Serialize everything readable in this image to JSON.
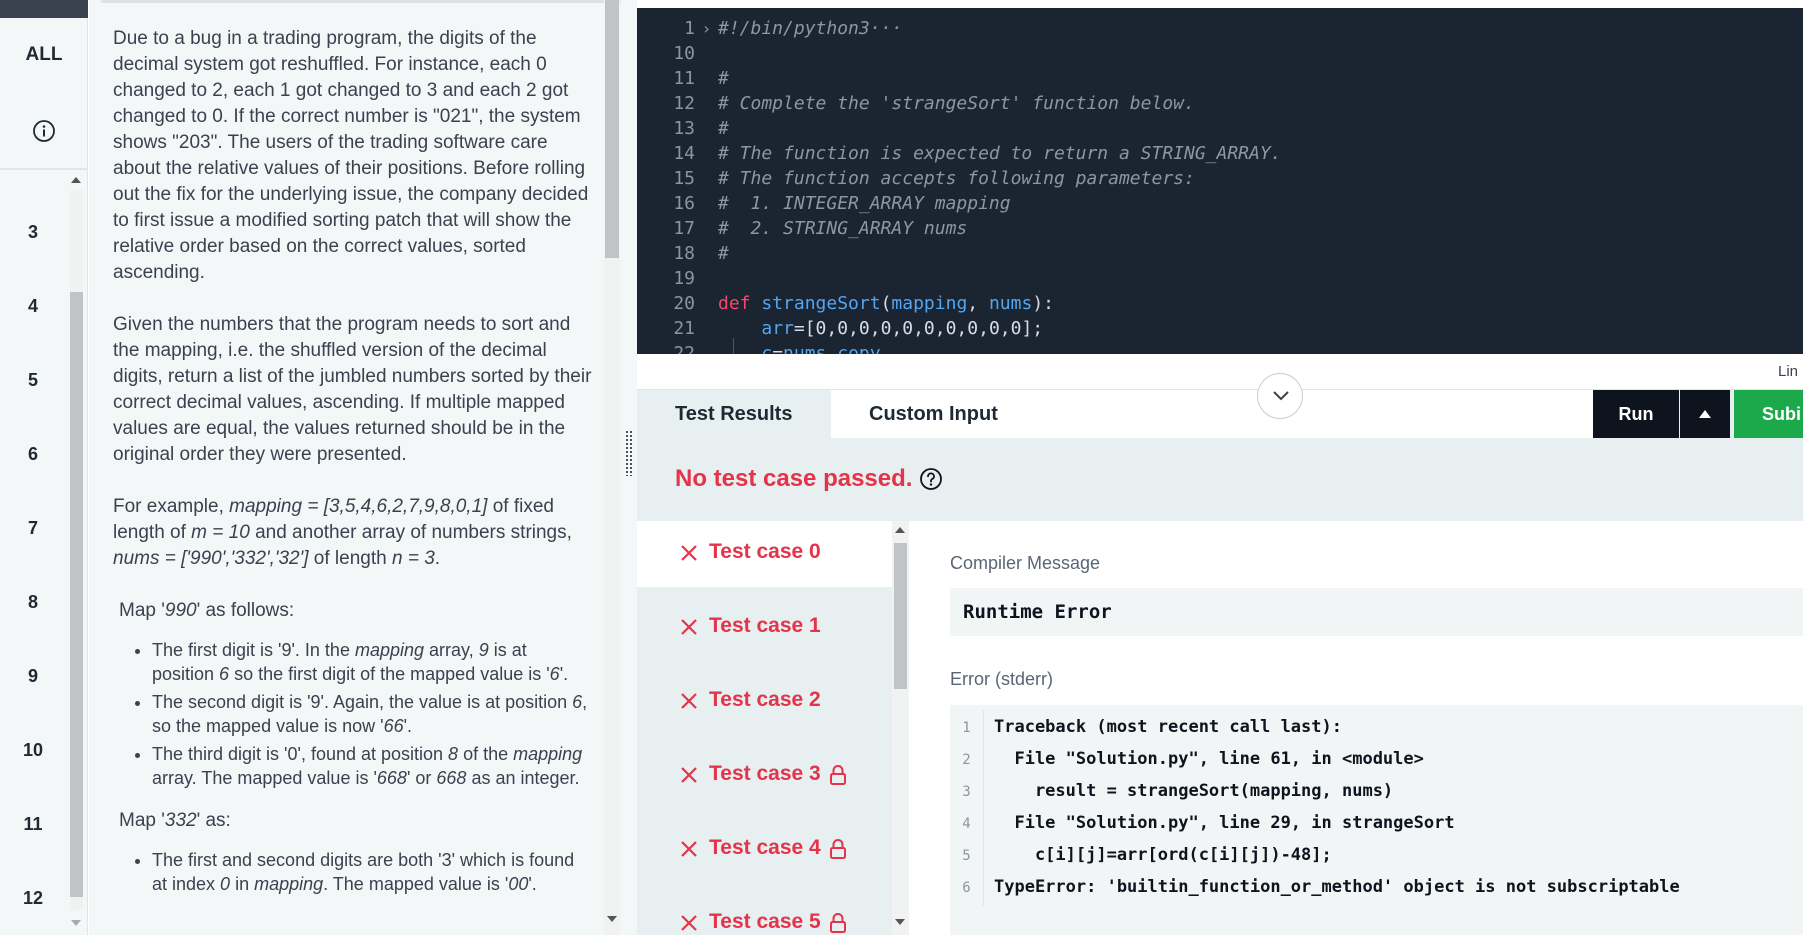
{
  "rail": {
    "all_label": "ALL",
    "numbers": [
      "3",
      "4",
      "5",
      "6",
      "7",
      "8",
      "9",
      "10",
      "11",
      "12"
    ]
  },
  "problem": {
    "p1": "Due to a bug in a trading program, the digits of the decimal system got reshuffled. For instance, each 0 changed to 2, each 1 got changed to 3 and each 2 got changed to 0. If the correct number is \"021\", the system shows \"203\". The users of the trading software care about the relative values of their positions.  Before rolling out the fix for the underlying issue, the company decided to first issue a modified sorting patch that will show the relative order based on the correct values, sorted ascending.",
    "p2": "Given the numbers that the program needs to sort and the mapping, i.e. the shuffled version of the decimal digits, return a list of the jumbled numbers sorted by their correct decimal values, ascending.  If multiple mapped values are equal, the values returned should be in the original order they were presented.",
    "p3_a": "For example, ",
    "p3_mapping": "mapping = [3,5,4,6,2,7,9,8,0,1]",
    "p3_b": " of fixed length of ",
    "p3_m": "m = 10",
    "p3_c": " and another array of numbers strings, ",
    "p3_nums": "nums = ['990','332','32']",
    "p3_d": " of length ",
    "p3_n": "n = 3",
    "p3_e": ".",
    "map1_a": "Map '",
    "map1_val": "990",
    "map1_b": "' as follows:",
    "b1_a": "The first digit is '9'.  In the ",
    "b1_mapping": "mapping",
    "b1_b": " array, ",
    "b1_9": "9",
    "b1_c": " is at position ",
    "b1_6": "6",
    "b1_d": " so the first digit of the mapped value is '",
    "b1_6b": "6",
    "b1_e": "'.",
    "b2_a": "The second digit is '9'.  Again, the value is at position ",
    "b2_6": "6",
    "b2_b": ", so the mapped value is now '",
    "b2_66": "66",
    "b2_c": "'.",
    "b3_a": "The third digit is '0', found at position ",
    "b3_8": "8",
    "b3_b": " of the ",
    "b3_mapping": "mapping",
    "b3_c": " array.  The mapped value is '",
    "b3_668": "668",
    "b3_d": "' or ",
    "b3_668b": "668",
    "b3_e": " as an integer.",
    "map2_a": "Map '",
    "map2_val": "332",
    "map2_b": "' as:",
    "b4_a": "The first and second digits are both '3' which is found at index ",
    "b4_0": "0",
    "b4_b": " in ",
    "b4_mapping": "mapping",
    "b4_c": ".  The mapped value is '",
    "b4_00": "00",
    "b4_d": "'."
  },
  "editor": {
    "lines": [
      {
        "n": "1",
        "fold": "›",
        "parts": [
          {
            "c": "c-comment",
            "t": "#!/bin/python3"
          },
          {
            "c": "c-comment",
            "t": "···"
          }
        ]
      },
      {
        "n": "10",
        "fold": "",
        "parts": []
      },
      {
        "n": "11",
        "fold": "",
        "parts": [
          {
            "c": "c-comment",
            "t": "#"
          }
        ]
      },
      {
        "n": "12",
        "fold": "",
        "parts": [
          {
            "c": "c-comment",
            "t": "# Complete the 'strangeSort' function below."
          }
        ]
      },
      {
        "n": "13",
        "fold": "",
        "parts": [
          {
            "c": "c-comment",
            "t": "#"
          }
        ]
      },
      {
        "n": "14",
        "fold": "",
        "parts": [
          {
            "c": "c-comment",
            "t": "# The function is expected to return a STRING_ARRAY."
          }
        ]
      },
      {
        "n": "15",
        "fold": "",
        "parts": [
          {
            "c": "c-comment",
            "t": "# The function accepts following parameters:"
          }
        ]
      },
      {
        "n": "16",
        "fold": "",
        "parts": [
          {
            "c": "c-comment",
            "t": "#  1. INTEGER_ARRAY mapping"
          }
        ]
      },
      {
        "n": "17",
        "fold": "",
        "parts": [
          {
            "c": "c-comment",
            "t": "#  2. STRING_ARRAY nums"
          }
        ]
      },
      {
        "n": "18",
        "fold": "",
        "parts": [
          {
            "c": "c-comment",
            "t": "#"
          }
        ]
      },
      {
        "n": "19",
        "fold": "",
        "parts": []
      },
      {
        "n": "20",
        "fold": "",
        "parts": [
          {
            "c": "c-kw",
            "t": "def "
          },
          {
            "c": "c-fn",
            "t": "strangeSort"
          },
          {
            "c": "c-plain",
            "t": "("
          },
          {
            "c": "c-param",
            "t": "mapping"
          },
          {
            "c": "c-plain",
            "t": ", "
          },
          {
            "c": "c-param",
            "t": "nums"
          },
          {
            "c": "c-plain",
            "t": "):"
          }
        ]
      },
      {
        "n": "21",
        "fold": "",
        "parts": [
          {
            "c": "c-plain",
            "t": "    "
          },
          {
            "c": "c-fn",
            "t": "arr"
          },
          {
            "c": "c-plain",
            "t": "=[0,0,0,0,0,0,0,0,0,0];"
          }
        ]
      },
      {
        "n": "22",
        "fold": "",
        "parts": [
          {
            "c": "c-plain",
            "t": "    "
          },
          {
            "c": "c-fn",
            "t": "c"
          },
          {
            "c": "c-plain",
            "t": "="
          },
          {
            "c": "c-fn",
            "t": "nums"
          },
          {
            "c": "c-plain",
            "t": "."
          },
          {
            "c": "c-fn",
            "t": "copy"
          }
        ]
      }
    ]
  },
  "status": {
    "line_col": "Lin"
  },
  "tabs": {
    "results": "Test Results",
    "custom": "Custom Input"
  },
  "actions": {
    "run": "Run",
    "submit": "Subi"
  },
  "results": {
    "fail_message": "No test case passed.",
    "cases": [
      {
        "label": "Test case 0",
        "locked": false
      },
      {
        "label": "Test case 1",
        "locked": false
      },
      {
        "label": "Test case 2",
        "locked": false
      },
      {
        "label": "Test case 3",
        "locked": true
      },
      {
        "label": "Test case 4",
        "locked": true
      },
      {
        "label": "Test case 5",
        "locked": true
      }
    ],
    "compiler_title": "Compiler Message",
    "compiler_message": "Runtime Error",
    "stderr_title": "Error (stderr)",
    "stderr_lines": [
      {
        "n": "1",
        "t": "Traceback (most recent call last):"
      },
      {
        "n": "2",
        "t": "  File \"Solution.py\", line 61, in <module>"
      },
      {
        "n": "3",
        "t": "    result = strangeSort(mapping, nums)"
      },
      {
        "n": "4",
        "t": "  File \"Solution.py\", line 29, in strangeSort"
      },
      {
        "n": "5",
        "t": "    c[i][j]=arr[ord(c[i][j])-48];"
      },
      {
        "n": "6",
        "t": "TypeError: 'builtin_function_or_method' object is not subscriptable"
      }
    ]
  },
  "colors": {
    "accent_fail": "#e4334a",
    "run_bg": "#0e141e",
    "submit_bg": "#1ba94c",
    "editor_bg": "#1b2431"
  }
}
